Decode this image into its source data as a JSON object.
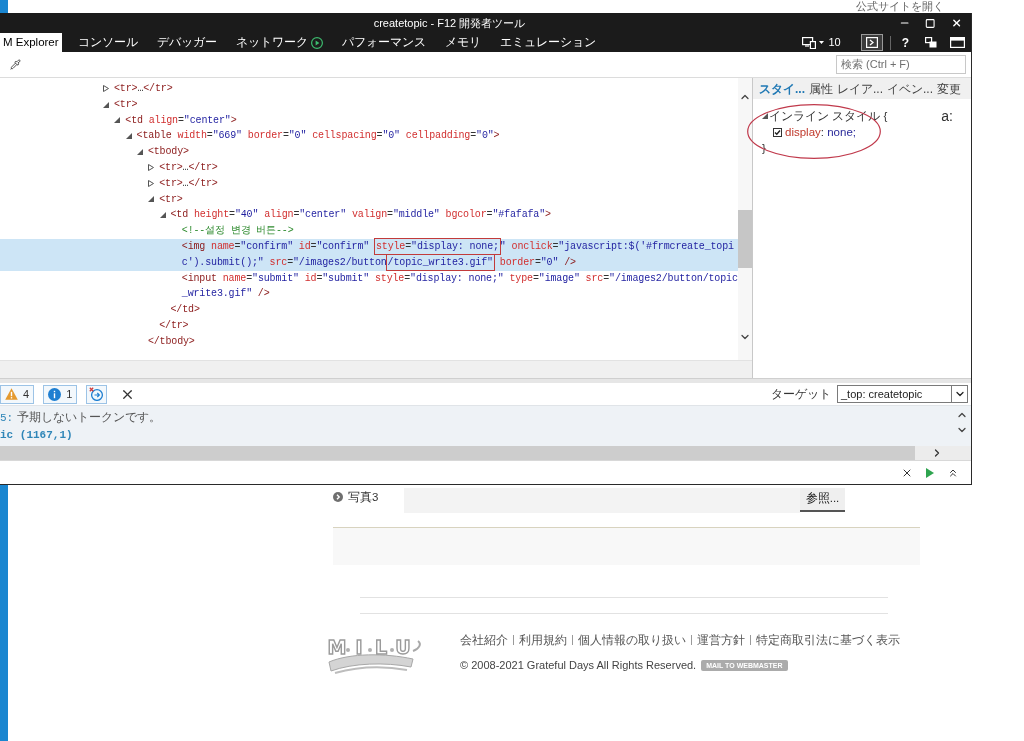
{
  "page_header": {
    "open_site_link": "公式サイトを開く"
  },
  "devtools": {
    "title": "createtopic - F12 開発者ツール",
    "tabs": [
      {
        "label": "M Explorer",
        "selected": true,
        "kind": "plain"
      },
      {
        "label": "コンソール",
        "selected": false,
        "kind": "plain"
      },
      {
        "label": "デバッガー",
        "selected": false,
        "kind": "plain"
      },
      {
        "label": "ネットワーク",
        "selected": false,
        "kind": "recording"
      },
      {
        "label": "パフォーマンス",
        "selected": false,
        "kind": "plain"
      },
      {
        "label": "メモリ",
        "selected": false,
        "kind": "plain"
      },
      {
        "label": "エミュレーション",
        "selected": false,
        "kind": "plain"
      }
    ],
    "document_mode": "10",
    "console_toggle": {
      "on": true
    },
    "help_label": "?",
    "search": {
      "placeholder": "検索 (Ctrl + F)"
    },
    "dom_tree": [
      {
        "kind": "container",
        "expanded": false,
        "selected": false,
        "lines": [
          [
            {
              "kind": "tag",
              "text": "<tr>"
            },
            {
              "kind": "punct",
              "text": "…"
            },
            {
              "kind": "tag",
              "text": "</tr>"
            }
          ]
        ]
      },
      {
        "kind": "container",
        "expanded": true,
        "selected": false,
        "lines": [
          [
            {
              "kind": "tag",
              "text": "<tr>"
            }
          ]
        ],
        "children": [
          {
            "kind": "container",
            "expanded": true,
            "selected": false,
            "lines": [
              [
                {
                  "kind": "tag",
                  "text": "<td"
                },
                {
                  "kind": "attr",
                  "text": " align"
                },
                {
                  "kind": "punct",
                  "text": "="
                },
                {
                  "kind": "value",
                  "text": "\"center\""
                },
                {
                  "kind": "tag",
                  "text": ">"
                }
              ]
            ],
            "children": [
              {
                "kind": "container",
                "expanded": true,
                "selected": false,
                "lines": [
                  [
                    {
                      "kind": "tag",
                      "text": "<table"
                    },
                    {
                      "kind": "attr",
                      "text": " width"
                    },
                    {
                      "kind": "punct",
                      "text": "="
                    },
                    {
                      "kind": "value",
                      "text": "\"669\""
                    },
                    {
                      "kind": "attr",
                      "text": " border"
                    },
                    {
                      "kind": "punct",
                      "text": "="
                    },
                    {
                      "kind": "value",
                      "text": "\"0\""
                    },
                    {
                      "kind": "attr",
                      "text": " cellspacing"
                    },
                    {
                      "kind": "punct",
                      "text": "="
                    },
                    {
                      "kind": "value",
                      "text": "\"0\""
                    },
                    {
                      "kind": "attr",
                      "text": " cellpadding"
                    },
                    {
                      "kind": "punct",
                      "text": "="
                    },
                    {
                      "kind": "value",
                      "text": "\"0\""
                    },
                    {
                      "kind": "tag",
                      "text": ">"
                    }
                  ]
                ],
                "children": [
                  {
                    "kind": "container",
                    "expanded": true,
                    "selected": false,
                    "lines": [
                      [
                        {
                          "kind": "tag",
                          "text": "<tbody>"
                        }
                      ]
                    ],
                    "closing": [
                      {
                        "kind": "tag",
                        "text": "</tbody>"
                      }
                    ],
                    "children": [
                      {
                        "kind": "container",
                        "expanded": false,
                        "selected": false,
                        "lines": [
                          [
                            {
                              "kind": "tag",
                              "text": "<tr>"
                            },
                            {
                              "kind": "punct",
                              "text": "…"
                            },
                            {
                              "kind": "tag",
                              "text": "</tr>"
                            }
                          ]
                        ]
                      },
                      {
                        "kind": "container",
                        "expanded": false,
                        "selected": false,
                        "lines": [
                          [
                            {
                              "kind": "tag",
                              "text": "<tr>"
                            },
                            {
                              "kind": "punct",
                              "text": "…"
                            },
                            {
                              "kind": "tag",
                              "text": "</tr>"
                            }
                          ]
                        ]
                      },
                      {
                        "kind": "container",
                        "expanded": true,
                        "selected": false,
                        "lines": [
                          [
                            {
                              "kind": "tag",
                              "text": "<tr>"
                            }
                          ]
                        ],
                        "closing": [
                          {
                            "kind": "tag",
                            "text": "</tr>"
                          }
                        ],
                        "children": [
                          {
                            "kind": "container",
                            "expanded": true,
                            "selected": false,
                            "lines": [
                              [
                                {
                                  "kind": "tag",
                                  "text": "<td"
                                },
                                {
                                  "kind": "attr",
                                  "text": " height"
                                },
                                {
                                  "kind": "punct",
                                  "text": "="
                                },
                                {
                                  "kind": "value",
                                  "text": "\"40\""
                                },
                                {
                                  "kind": "attr",
                                  "text": " align"
                                },
                                {
                                  "kind": "punct",
                                  "text": "="
                                },
                                {
                                  "kind": "value",
                                  "text": "\"center\""
                                },
                                {
                                  "kind": "attr",
                                  "text": " valign"
                                },
                                {
                                  "kind": "punct",
                                  "text": "="
                                },
                                {
                                  "kind": "value",
                                  "text": "\"middle\""
                                },
                                {
                                  "kind": "attr",
                                  "text": " bgcolor"
                                },
                                {
                                  "kind": "punct",
                                  "text": "="
                                },
                                {
                                  "kind": "value",
                                  "text": "\"#fafafa\""
                                },
                                {
                                  "kind": "tag",
                                  "text": ">"
                                }
                              ]
                            ],
                            "closing": [
                              {
                                "kind": "tag",
                                "text": "</td>"
                              }
                            ],
                            "children": [
                              {
                                "kind": "leaf",
                                "selected": false,
                                "lines": [
                                  [
                                    {
                                      "kind": "comment",
                                      "text": "<!--설정 변경 버튼-->"
                                    }
                                  ]
                                ]
                              },
                              {
                                "kind": "leaf",
                                "selected": true,
                                "lines": [
                                  [
                                    {
                                      "kind": "tag",
                                      "text": "<img"
                                    },
                                    {
                                      "kind": "attr",
                                      "text": " name"
                                    },
                                    {
                                      "kind": "punct",
                                      "text": "="
                                    },
                                    {
                                      "kind": "value",
                                      "text": "\"confirm\""
                                    },
                                    {
                                      "kind": "attr",
                                      "text": " id"
                                    },
                                    {
                                      "kind": "punct",
                                      "text": "="
                                    },
                                    {
                                      "kind": "value",
                                      "text": "\"confirm\" "
                                    },
                                    {
                                      "kind": "box",
                                      "tokens": [
                                        {
                                          "kind": "attr",
                                          "text": "style"
                                        },
                                        {
                                          "kind": "punct",
                                          "text": "="
                                        },
                                        {
                                          "kind": "value",
                                          "text": "\"display: none;"
                                        }
                                      ]
                                    },
                                    {
                                      "kind": "value",
                                      "text": "\""
                                    },
                                    {
                                      "kind": "attr",
                                      "text": " onclick"
                                    },
                                    {
                                      "kind": "punct",
                                      "text": "="
                                    },
                                    {
                                      "kind": "value",
                                      "text": "\"javascript:$('#frmcreate_topi"
                                    }
                                  ],
                                  [
                                    {
                                      "kind": "value",
                                      "text": "c').submit();\""
                                    },
                                    {
                                      "kind": "attr",
                                      "text": " src"
                                    },
                                    {
                                      "kind": "punct",
                                      "text": "="
                                    },
                                    {
                                      "kind": "value",
                                      "text": "\"/images2/button"
                                    },
                                    {
                                      "kind": "box",
                                      "tokens": [
                                        {
                                          "kind": "value",
                                          "text": "/topic_write3.gif\""
                                        }
                                      ]
                                    },
                                    {
                                      "kind": "attr",
                                      "text": " border"
                                    },
                                    {
                                      "kind": "punct",
                                      "text": "="
                                    },
                                    {
                                      "kind": "value",
                                      "text": "\"0\""
                                    },
                                    {
                                      "kind": "tag",
                                      "text": " />"
                                    }
                                  ]
                                ]
                              },
                              {
                                "kind": "leaf",
                                "selected": false,
                                "lines": [
                                  [
                                    {
                                      "kind": "tag",
                                      "text": "<input"
                                    },
                                    {
                                      "kind": "attr",
                                      "text": " name"
                                    },
                                    {
                                      "kind": "punct",
                                      "text": "="
                                    },
                                    {
                                      "kind": "value",
                                      "text": "\"submit\""
                                    },
                                    {
                                      "kind": "attr",
                                      "text": " id"
                                    },
                                    {
                                      "kind": "punct",
                                      "text": "="
                                    },
                                    {
                                      "kind": "value",
                                      "text": "\"submit\""
                                    },
                                    {
                                      "kind": "attr",
                                      "text": " style"
                                    },
                                    {
                                      "kind": "punct",
                                      "text": "="
                                    },
                                    {
                                      "kind": "value",
                                      "text": "\"display: none;\""
                                    },
                                    {
                                      "kind": "attr",
                                      "text": " type"
                                    },
                                    {
                                      "kind": "punct",
                                      "text": "="
                                    },
                                    {
                                      "kind": "value",
                                      "text": "\"image\""
                                    },
                                    {
                                      "kind": "attr",
                                      "text": " src"
                                    },
                                    {
                                      "kind": "punct",
                                      "text": "="
                                    },
                                    {
                                      "kind": "value",
                                      "text": "\"/images2/button/topic"
                                    }
                                  ],
                                  [
                                    {
                                      "kind": "value",
                                      "text": "_write3.gif\""
                                    },
                                    {
                                      "kind": "tag",
                                      "text": " />"
                                    }
                                  ]
                                ]
                              }
                            ]
                          }
                        ]
                      }
                    ]
                  }
                ]
              }
            ]
          }
        ]
      }
    ],
    "styles_panel": {
      "tabs": [
        {
          "label": "スタイ...",
          "selected": true
        },
        {
          "label": "属性",
          "selected": false
        },
        {
          "label": "レイア...",
          "selected": false
        },
        {
          "label": "イベン...",
          "selected": false
        },
        {
          "label": "変更",
          "selected": false
        }
      ],
      "pseudo_label": "a:",
      "rules": [
        {
          "label": "インライン スタイル {",
          "expanded": true,
          "properties": [
            {
              "name": "display",
              "separator": ":",
              "value": "none;",
              "checked": true
            }
          ],
          "closing": "}"
        }
      ]
    },
    "console": {
      "filters": [
        {
          "kind": "warning",
          "count": "4"
        },
        {
          "kind": "info",
          "count": "1"
        }
      ],
      "target_label": "ターゲット",
      "target_value": "_top: createtopic",
      "messages": [
        {
          "link": "5:",
          "text": " 予期しないトークンです。"
        },
        {
          "link": "ic (1167,1)"
        }
      ]
    }
  },
  "page": {
    "photo_field": {
      "label": "写真3",
      "button": "参照..."
    },
    "logo": {
      "letters": [
        "M",
        "I",
        "L",
        "U"
      ]
    },
    "footer_links": [
      "会社紹介",
      "利用規約",
      "個人情報の取り扱い",
      "運営方針",
      "特定商取引法に基づく表示"
    ],
    "copyright": "© 2008-2021 Grateful Days All Rights Reserved.",
    "mail_badge": "MAIL TO WEBMASTER"
  }
}
